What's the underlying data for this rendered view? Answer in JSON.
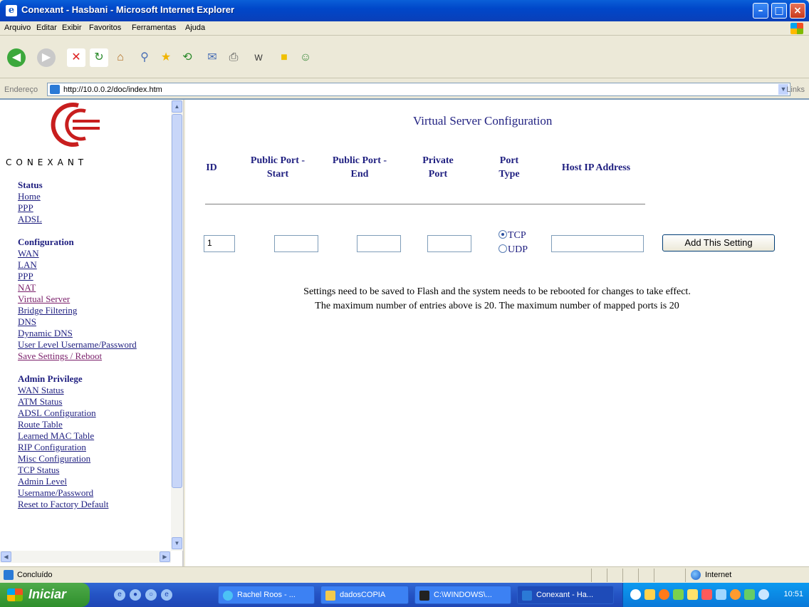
{
  "window": {
    "title": "Conexant - Hasbani - Microsoft Internet Explorer"
  },
  "menu": [
    "Arquivo",
    "Editar",
    "Exibir",
    "Favoritos",
    "Ferramentas",
    "Ajuda"
  ],
  "address": {
    "label": "Endereço",
    "url": "http://10.0.0.2/doc/index.htm",
    "links": "Links"
  },
  "brand": "CONEXANT",
  "nav": {
    "status": {
      "title": "Status",
      "items": [
        "Home",
        "PPP",
        "ADSL"
      ]
    },
    "configuration": {
      "title": "Configuration",
      "items": [
        "WAN",
        "LAN",
        "PPP",
        "NAT",
        "Virtual Server",
        "Bridge Filtering",
        "DNS",
        "Dynamic DNS",
        "User Level Username/Password",
        "Save Settings / Reboot"
      ]
    },
    "admin": {
      "title": "Admin Privilege",
      "items": [
        "WAN Status",
        "ATM Status",
        "ADSL Configuration",
        "Route Table",
        "Learned MAC Table",
        "RIP Configuration",
        "Misc Configuration",
        "TCP Status",
        "Admin Level",
        "Username/Password",
        "Reset to Factory Default"
      ]
    }
  },
  "content": {
    "title": "Virtual Server Configuration",
    "headers": {
      "id": "ID",
      "pps1": "Public Port -",
      "pps2": "Start",
      "ppe1": "Public Port -",
      "ppe2": "End",
      "pp1": "Private",
      "pp2": "Port",
      "pt1": "Port",
      "pt2": "Type",
      "host": "Host IP Address"
    },
    "id_value": "1",
    "radio": {
      "tcp": "TCP",
      "udp": "UDP",
      "selected": "TCP"
    },
    "add_button": "Add This Setting",
    "note1": "Settings need to be saved to Flash and the system needs to be rebooted for changes to take effect.",
    "note2": "The maximum number of entries above is 20. The maximum number of mapped ports is 20"
  },
  "status": {
    "text": "Concluído",
    "zone": "Internet"
  },
  "taskbar": {
    "start": "Iniciar",
    "tasks": [
      "Rachel Roos - ...",
      "dadosCOPIA",
      "C:\\WINDOWS\\...",
      "Conexant - Ha..."
    ],
    "clock": "10:51"
  }
}
